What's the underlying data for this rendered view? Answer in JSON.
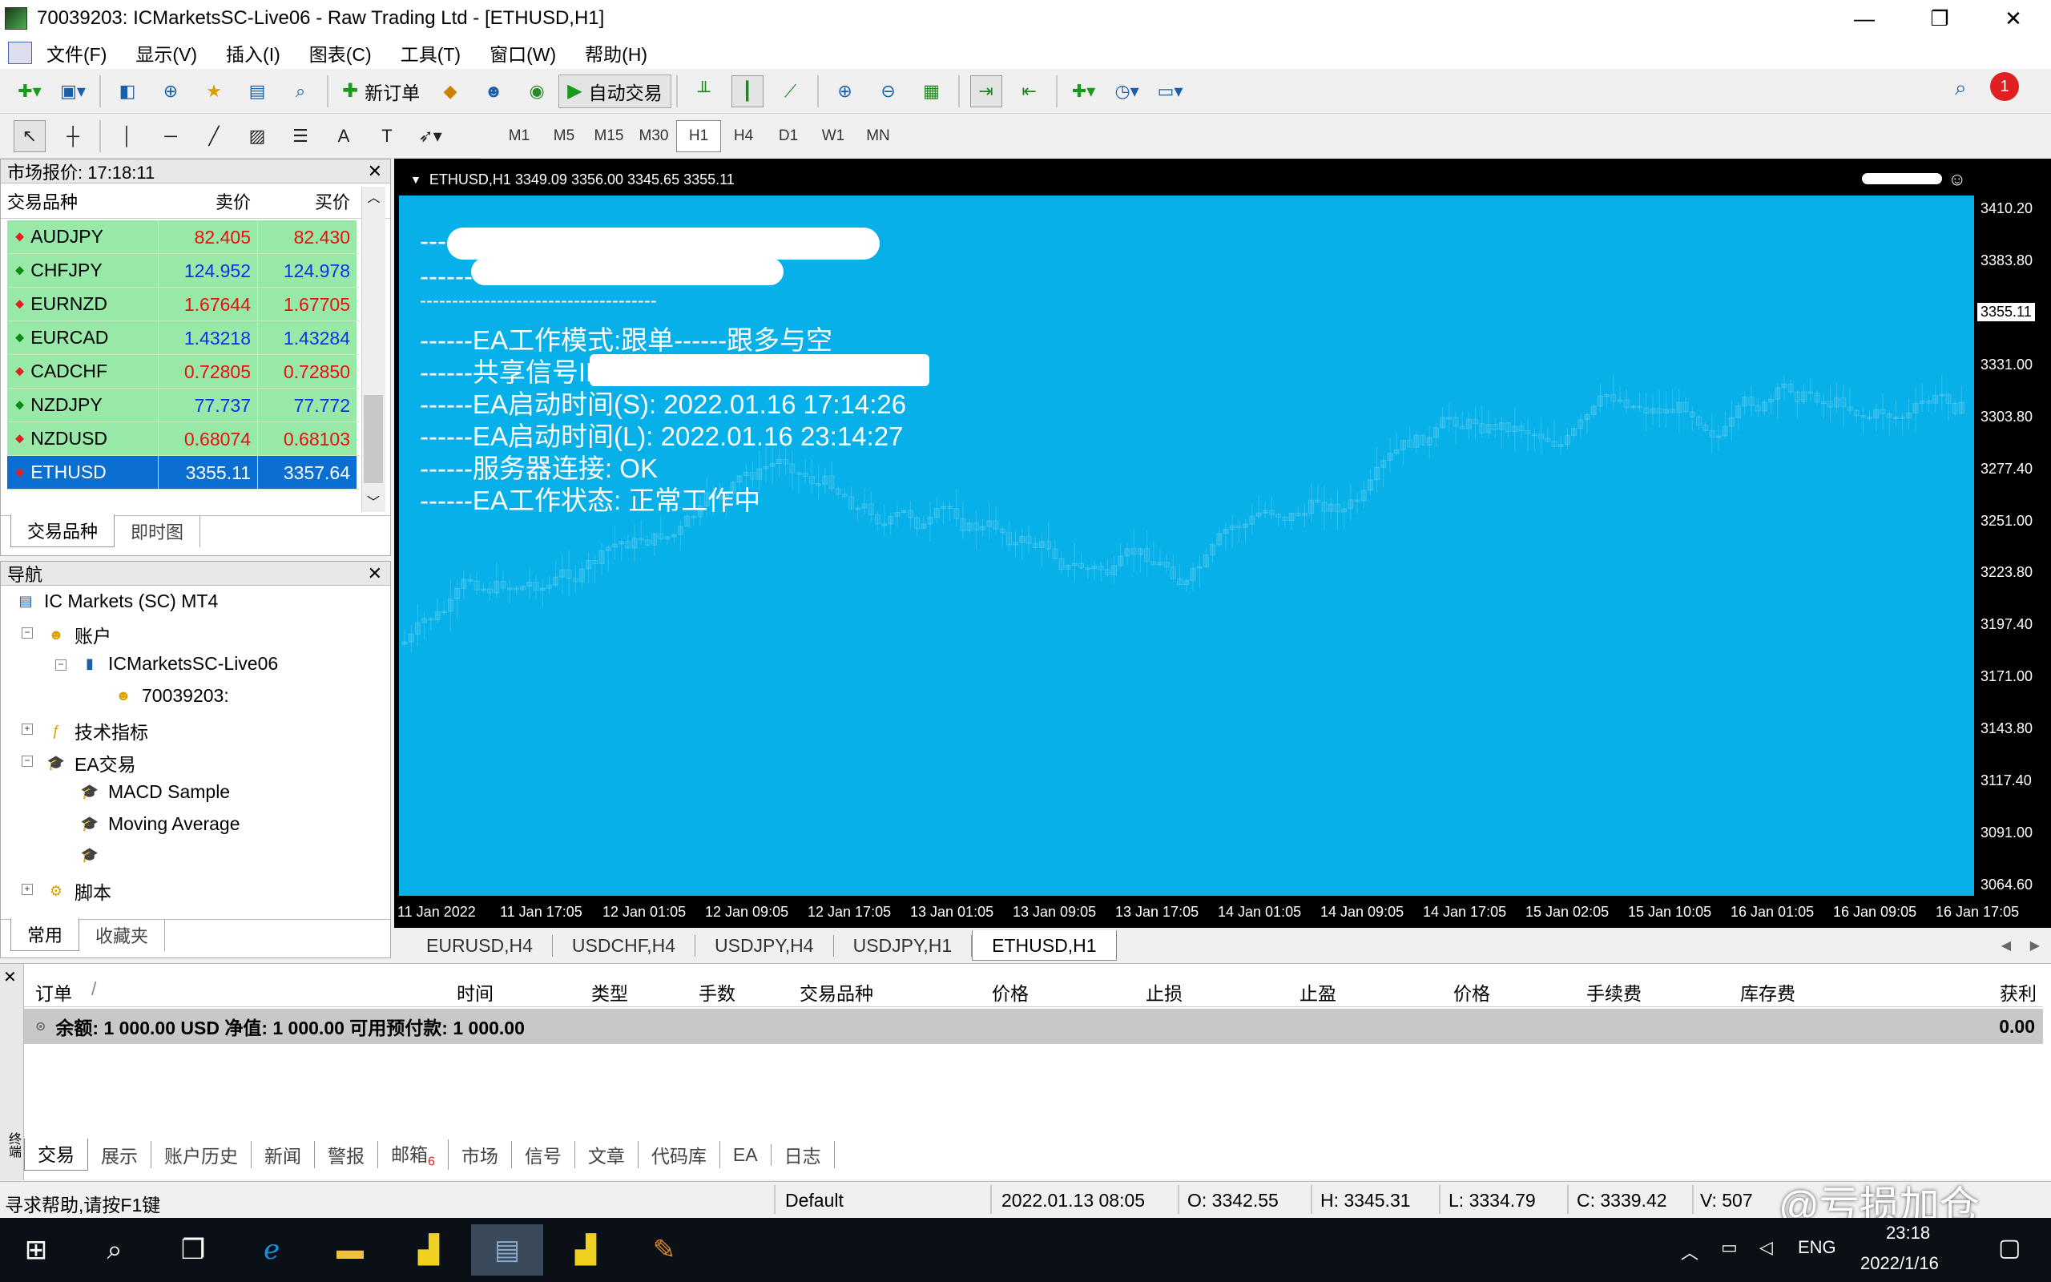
{
  "window": {
    "title": "70039203: ICMarketsSC-Live06 - Raw Trading Ltd - [ETHUSD,H1]",
    "minimize": "—",
    "restore": "❐",
    "close": "✕"
  },
  "menu": [
    "文件(F)",
    "显示(V)",
    "插入(I)",
    "图表(C)",
    "工具(T)",
    "窗口(W)",
    "帮助(H)"
  ],
  "toolbar": {
    "new_order": "新订单",
    "auto_trade": "自动交易",
    "notification_count": "1"
  },
  "timeframes": [
    "M1",
    "M5",
    "M15",
    "M30",
    "H1",
    "H4",
    "D1",
    "W1",
    "MN"
  ],
  "active_timeframe": "H1",
  "market_watch": {
    "title": "市场报价: 17:18:11",
    "col_symbol": "交易品种",
    "col_bid": "卖价",
    "col_ask": "买价",
    "rows": [
      {
        "symbol": "AUDJPY",
        "bid": "82.405",
        "ask": "82.430",
        "dir": "down"
      },
      {
        "symbol": "CHFJPY",
        "bid": "124.952",
        "ask": "124.978",
        "dir": "up"
      },
      {
        "symbol": "EURNZD",
        "bid": "1.67644",
        "ask": "1.67705",
        "dir": "down"
      },
      {
        "symbol": "EURCAD",
        "bid": "1.43218",
        "ask": "1.43284",
        "dir": "up"
      },
      {
        "symbol": "CADCHF",
        "bid": "0.72805",
        "ask": "0.72850",
        "dir": "down"
      },
      {
        "symbol": "NZDJPY",
        "bid": "77.737",
        "ask": "77.772",
        "dir": "up"
      },
      {
        "symbol": "NZDUSD",
        "bid": "0.68074",
        "ask": "0.68103",
        "dir": "down"
      },
      {
        "symbol": "ETHUSD",
        "bid": "3355.11",
        "ask": "3357.64",
        "dir": "down"
      }
    ],
    "tab_symbols": "交易品种",
    "tab_tick": "即时图"
  },
  "navigator": {
    "title": "导航",
    "root": "IC Markets (SC) MT4",
    "accounts": "账户",
    "server": "ICMarketsSC-Live06",
    "account": "70039203:",
    "indicators": "技术指标",
    "experts": "EA交易",
    "ea1": "MACD Sample",
    "ea2": "Moving Average",
    "scripts": "脚本",
    "tab_common": "常用",
    "tab_favorites": "收藏夹"
  },
  "chart": {
    "header": "ETHUSD,H1  3349.09 3356.00 3345.65 3355.11",
    "current_price": "3355.11",
    "background": "#07b0e8",
    "price_labels": [
      "3410.20",
      "3383.80",
      "3357.40",
      "3331.00",
      "3303.80",
      "3277.40",
      "3251.00",
      "3223.80",
      "3197.40",
      "3171.00",
      "3143.80",
      "3117.40",
      "3091.00",
      "3064.60"
    ],
    "time_labels": [
      "11 Jan 2022",
      "11 Jan 17:05",
      "12 Jan 01:05",
      "12 Jan 09:05",
      "12 Jan 17:05",
      "13 Jan 01:05",
      "13 Jan 09:05",
      "13 Jan 17:05",
      "14 Jan 01:05",
      "14 Jan 09:05",
      "14 Jan 17:05",
      "15 Jan 02:05",
      "15 Jan 10:05",
      "16 Jan 01:05",
      "16 Jan 09:05",
      "16 Jan 17:05"
    ],
    "overlay": [
      "------",
      "------",
      "-------------------------------------",
      "------EA工作模式:跟单------跟多与空",
      "------共享信号ID:",
      "------EA启动时间(S): 2022.01.16 17:14:26",
      "------EA启动时间(L): 2022.01.16 23:14:27",
      "------服务器连接: OK",
      "------EA工作状态: 正常工作中"
    ]
  },
  "chart_tabs": [
    "EURUSD,H4",
    "USDCHF,H4",
    "USDJPY,H4",
    "USDJPY,H1",
    "ETHUSD,H1"
  ],
  "active_chart_tab": "ETHUSD,H1",
  "terminal": {
    "columns": [
      "订单",
      "/",
      "时间",
      "类型",
      "手数",
      "交易品种",
      "价格",
      "止损",
      "止盈",
      "价格",
      "手续费",
      "库存费",
      "获利"
    ],
    "balance_line": "余额: 1 000.00 USD  净值: 1 000.00  可用预付款: 1 000.00",
    "profit": "0.00",
    "tabs": [
      "交易",
      "展示",
      "账户历史",
      "新闻",
      "警报",
      "邮箱",
      "市场",
      "信号",
      "文章",
      "代码库",
      "EA",
      "日志"
    ],
    "mail_badge": "6",
    "side_label": "终端"
  },
  "status": {
    "help": "寻求帮助,请按F1键",
    "profile": "Default",
    "datetime": "2022.01.13 08:05",
    "open": "O: 3342.55",
    "high": "H: 3345.31",
    "low": "L: 3334.79",
    "close": "C: 3339.42",
    "volume": "V: 507",
    "watermark": "@亏损加仓"
  },
  "tray": {
    "lang": "ENG",
    "time": "23:18",
    "date": "2022/1/16"
  }
}
